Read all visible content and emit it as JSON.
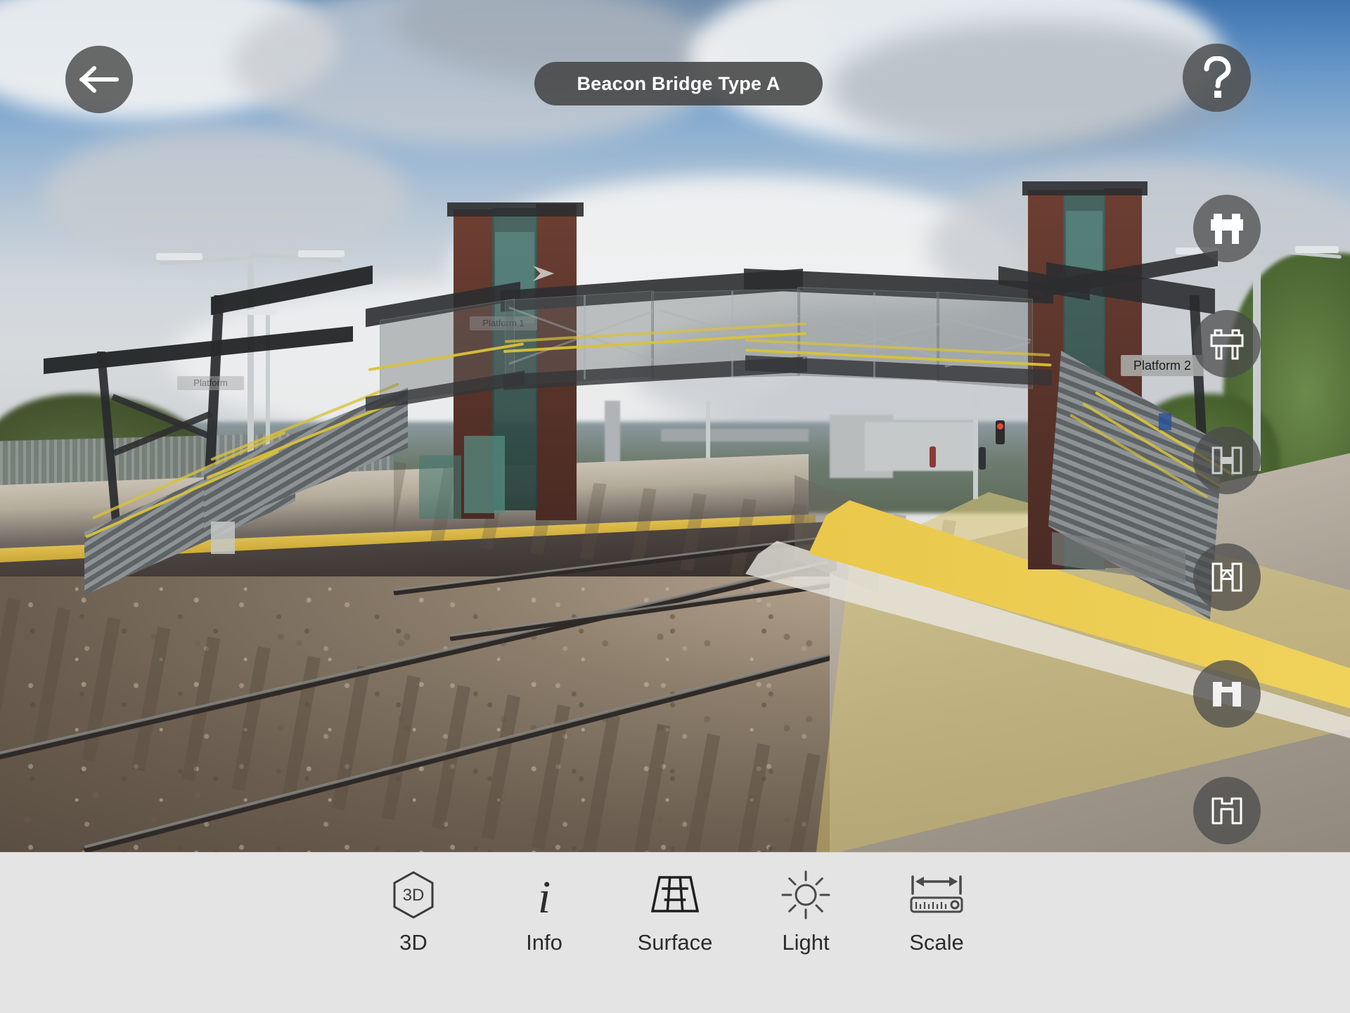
{
  "app": {
    "title": "Beacon Bridge Type A",
    "mode": "augmented-reality-model-viewer"
  },
  "header": {
    "back_label": "Back",
    "back_icon": "arrow-left-icon",
    "title": "Beacon Bridge Type A",
    "help_label": "Help",
    "help_icon": "question-mark-icon"
  },
  "variants": {
    "items": [
      {
        "id": "deck-bridge-solid",
        "icon": "bridge-deck-filled-icon",
        "label": "Deck bridge solid",
        "selected": true
      },
      {
        "id": "deck-bridge-outline",
        "icon": "bridge-deck-outline-icon",
        "label": "Deck bridge outline",
        "selected": false
      },
      {
        "id": "beam-bridge-solid",
        "icon": "h-beam-filled-icon",
        "label": "Beam bridge solid",
        "selected": false
      },
      {
        "id": "beam-bridge-truss",
        "icon": "h-beam-truss-icon",
        "label": "Beam bridge truss",
        "selected": false
      },
      {
        "id": "portal-bridge-solid",
        "icon": "portal-arch-filled-icon",
        "label": "Portal bridge solid",
        "selected": false
      },
      {
        "id": "portal-bridge-outline",
        "icon": "portal-arch-outline-icon",
        "label": "Portal bridge outline",
        "selected": false
      }
    ]
  },
  "scene": {
    "model_labels": [
      {
        "text": "Platform 1",
        "position": "bridge-tower-left"
      },
      {
        "text": "Platform",
        "position": "canopy-left"
      },
      {
        "text": "Platform 2",
        "position": "stair-right"
      }
    ]
  },
  "toolbar": {
    "items": [
      {
        "id": "3d",
        "icon": "hexagon-3d-icon",
        "label": "3D"
      },
      {
        "id": "info",
        "icon": "info-italic-i-icon",
        "label": "Info"
      },
      {
        "id": "surface",
        "icon": "perspective-grid-icon",
        "label": "Surface"
      },
      {
        "id": "light",
        "icon": "sun-icon",
        "label": "Light"
      },
      {
        "id": "scale",
        "icon": "ruler-arrow-icon",
        "label": "Scale"
      }
    ]
  },
  "colors": {
    "toolbar_background": "#e4e4e4",
    "toolbar_text": "#2b2b2b",
    "overlay_button": "#4a4a4a",
    "overlay_text": "#ffffff",
    "handrail_yellow": "#d8c23a",
    "platform_line_yellow": "#e9c84b"
  }
}
